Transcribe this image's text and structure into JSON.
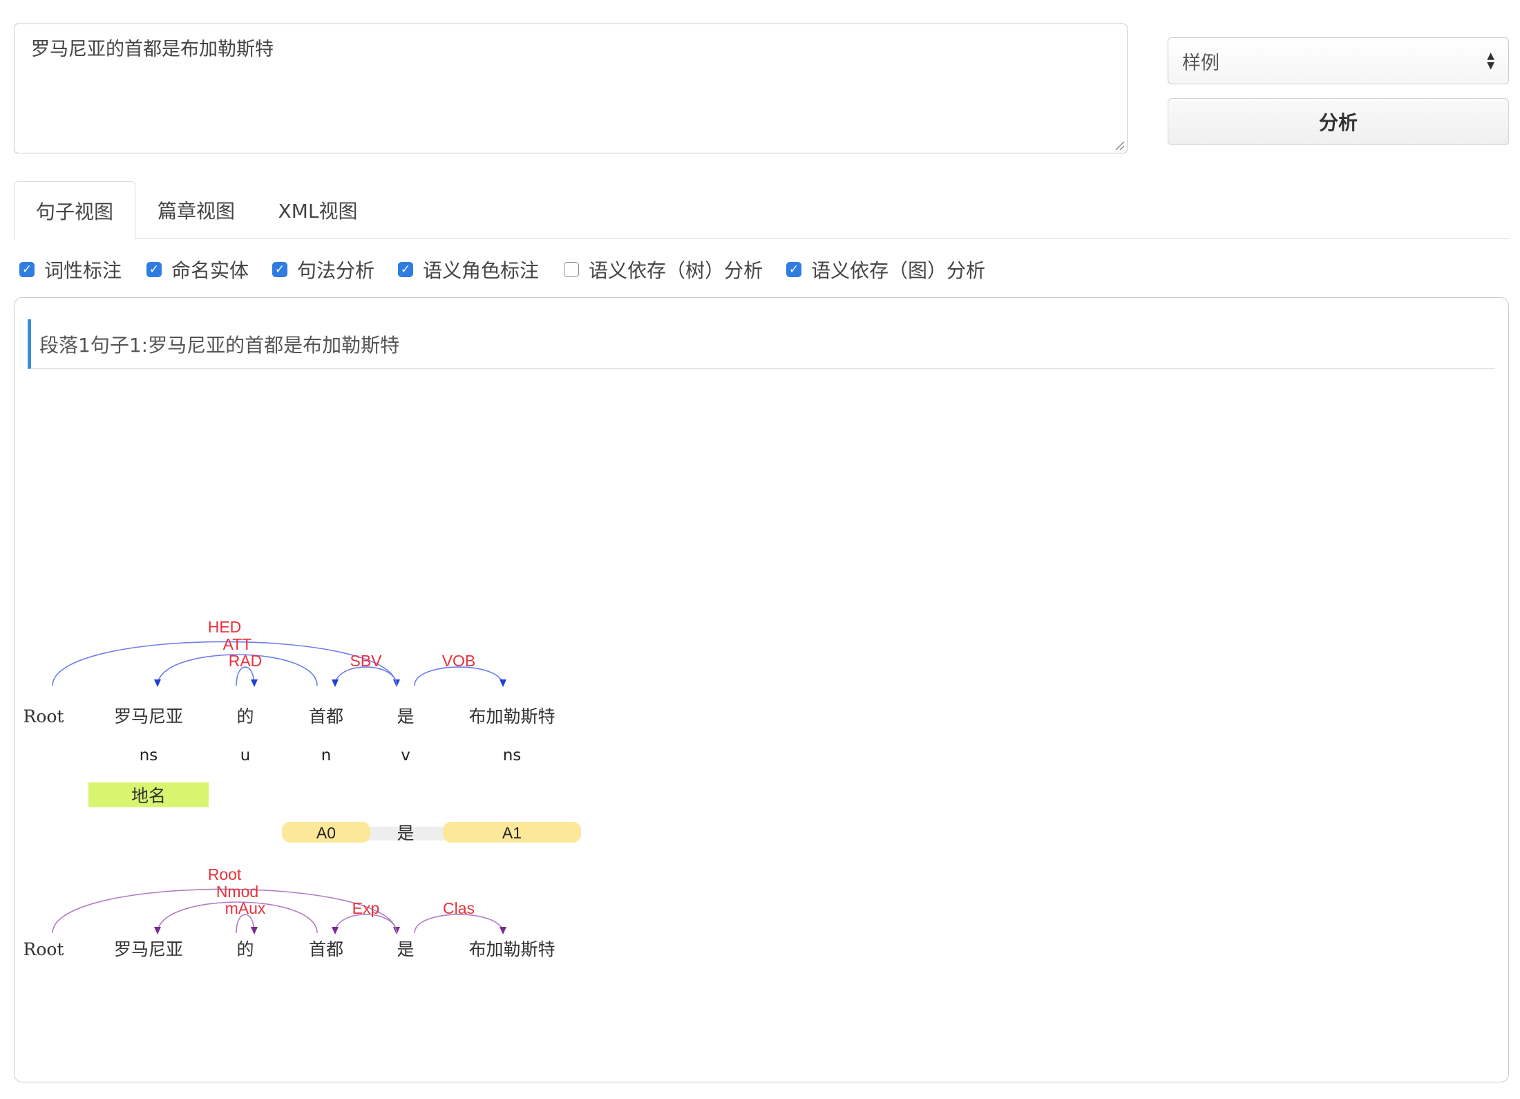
{
  "input": {
    "text": "罗马尼亚的首都是布加勒斯特"
  },
  "sample_select": {
    "value": "样例"
  },
  "analyze_button": {
    "label": "分析"
  },
  "tabs": [
    {
      "label": "句子视图",
      "active": true
    },
    {
      "label": "篇章视图",
      "active": false
    },
    {
      "label": "XML视图",
      "active": false
    }
  ],
  "options": [
    {
      "label": "词性标注",
      "checked": true
    },
    {
      "label": "命名实体",
      "checked": true
    },
    {
      "label": "句法分析",
      "checked": true
    },
    {
      "label": "语义角色标注",
      "checked": true
    },
    {
      "label": "语义依存（树）分析",
      "checked": false
    },
    {
      "label": "语义依存（图）分析",
      "checked": true
    }
  ],
  "result": {
    "header": "段落1句子1:罗马尼亚的首都是布加勒斯特",
    "root_label": "Root",
    "words": [
      "罗马尼亚",
      "的",
      "首都",
      "是",
      "布加勒斯特"
    ],
    "pos": [
      "ns",
      "u",
      "n",
      "v",
      "ns"
    ],
    "ner": [
      {
        "word_index": 0,
        "label": "地名",
        "color": "#d8f56f"
      }
    ],
    "srl": {
      "predicate_index": 3,
      "predicate": "是",
      "args": [
        {
          "label": "A0",
          "word_index": 2,
          "color": "#fde89a"
        },
        {
          "label": "A1",
          "word_index": 4,
          "color": "#fde89a"
        }
      ]
    },
    "syntax_arcs": [
      {
        "head": 0,
        "dep": 4,
        "label": "HED"
      },
      {
        "head": 3,
        "dep": 1,
        "label": "ATT"
      },
      {
        "head": 2,
        "dep": 2,
        "label": "RAD"
      },
      {
        "head": 4,
        "dep": 3,
        "label": "SBV"
      },
      {
        "head": 4,
        "dep": 5,
        "label": "VOB"
      }
    ],
    "semantic_arcs": [
      {
        "head": 0,
        "dep": 4,
        "label": "Root"
      },
      {
        "head": 3,
        "dep": 1,
        "label": "Nmod"
      },
      {
        "head": 2,
        "dep": 2,
        "label": "mAux"
      },
      {
        "head": 4,
        "dep": 3,
        "label": "Exp"
      },
      {
        "head": 4,
        "dep": 5,
        "label": "Clas"
      }
    ],
    "colors": {
      "syntax_arc": "#6f7df0",
      "syntax_arrow": "#1e3fd8",
      "semantic_arc": "#b07cc6",
      "semantic_arrow": "#7a2a92",
      "arc_label": "#e8313a"
    }
  }
}
